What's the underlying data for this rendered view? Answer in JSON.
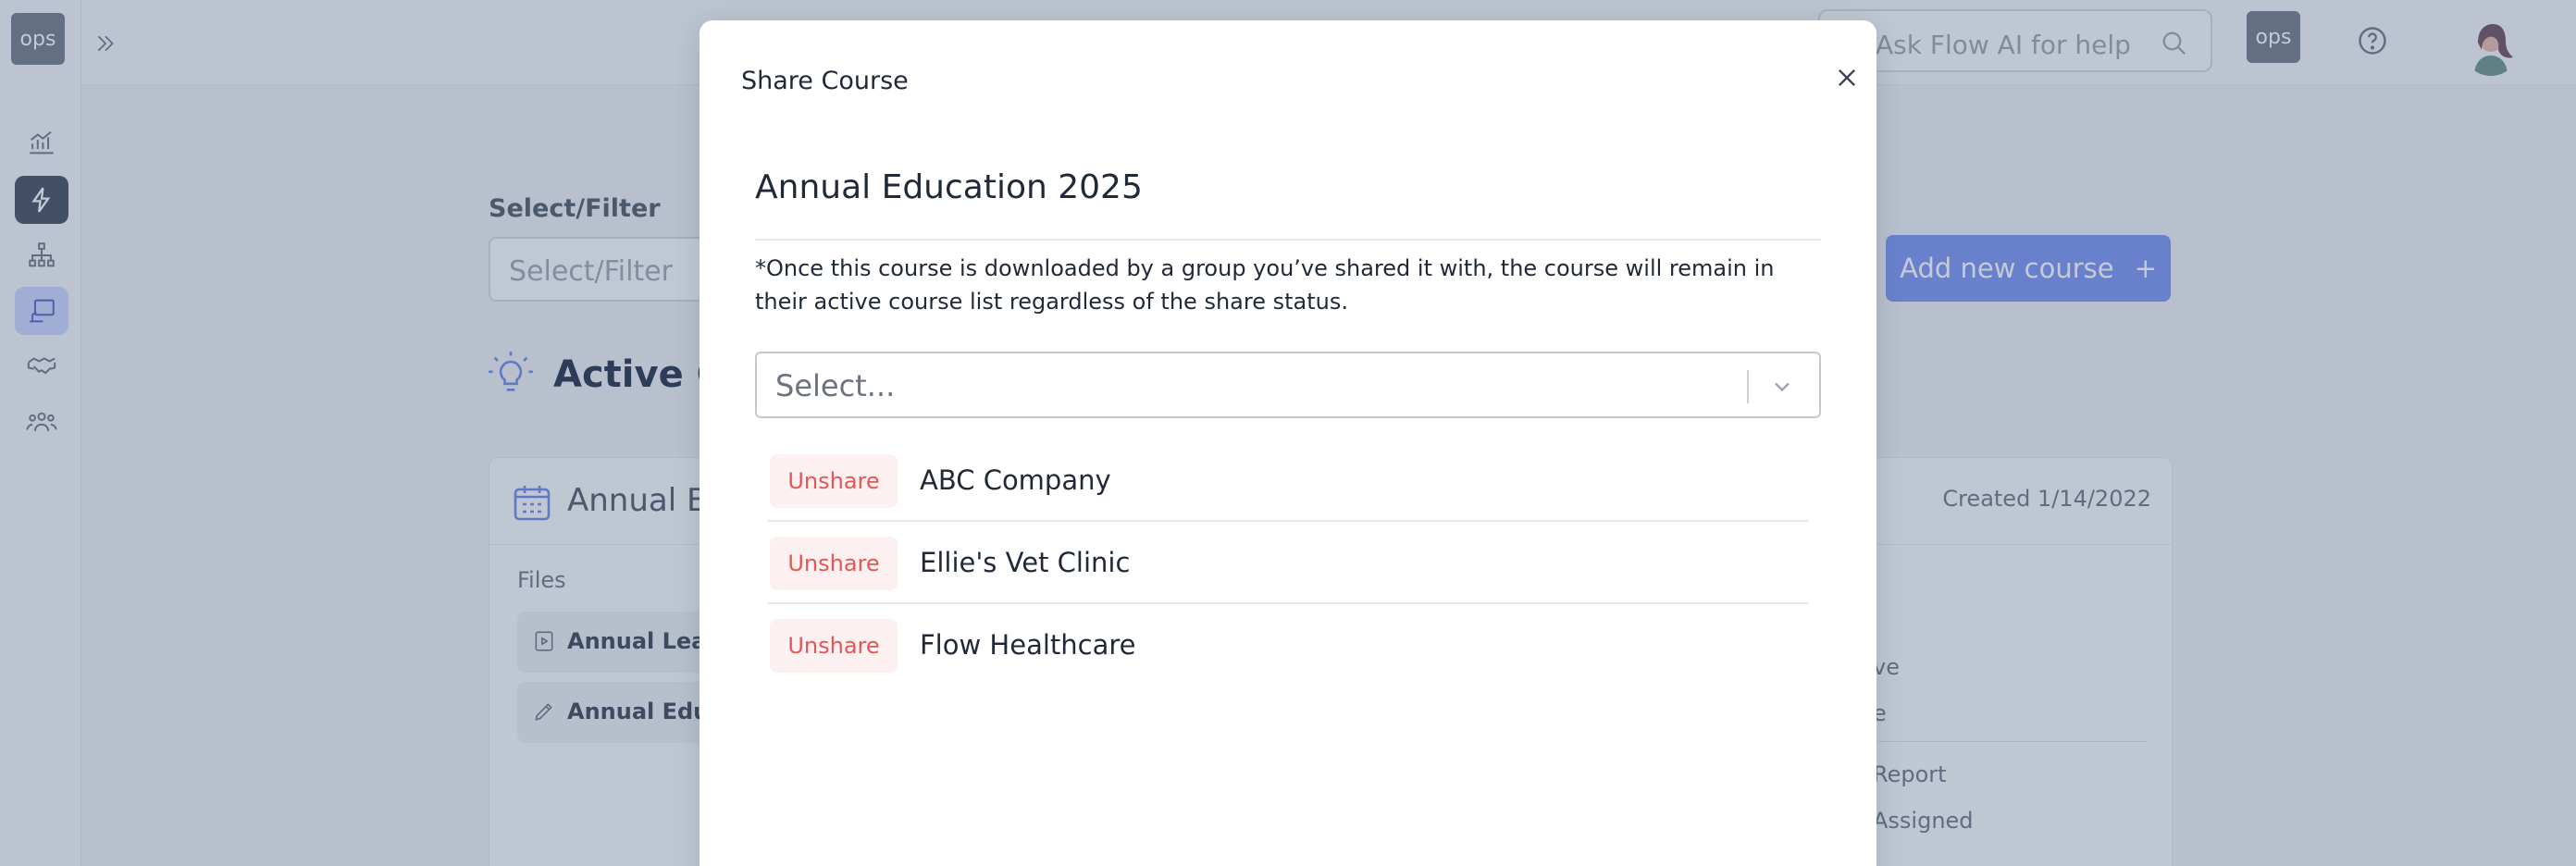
{
  "app": {
    "logo_text": "ops",
    "sidebar_icons": [
      "analytics-icon",
      "lightning-icon",
      "org-chart-icon",
      "course-icon",
      "handshake-icon",
      "team-icon"
    ],
    "search_placeholder": "Ask Flow AI for help",
    "ops_badge": "ops"
  },
  "background": {
    "filter_label": "Select/Filter",
    "filter_placeholder": "Select/Filter",
    "add_course_label": "Add new course",
    "add_course_plus": "+",
    "active_title": "Active Co",
    "card_title": "Annual Ed",
    "created": "Created 1/14/2022",
    "files_label": "Files",
    "files": [
      "Annual Learn",
      "Annual Educa"
    ],
    "right_items": [
      "ve",
      "e",
      "Report",
      "Assigned"
    ]
  },
  "modal": {
    "title": "Share Course",
    "course_name": "Annual Education 2025",
    "notice": "*Once this course is downloaded by a group you’ve shared it with, the course will remain in their active course list regardless of the share status.",
    "select_placeholder": "Select...",
    "unshare_label": "Unshare",
    "shared_groups": [
      {
        "name": "ABC Company"
      },
      {
        "name": "Ellie's Vet Clinic"
      },
      {
        "name": "Flow Healthcare"
      }
    ]
  },
  "colors": {
    "accent": "#7890f0",
    "danger": "#e25757",
    "danger_bg": "#fdf0f0"
  }
}
